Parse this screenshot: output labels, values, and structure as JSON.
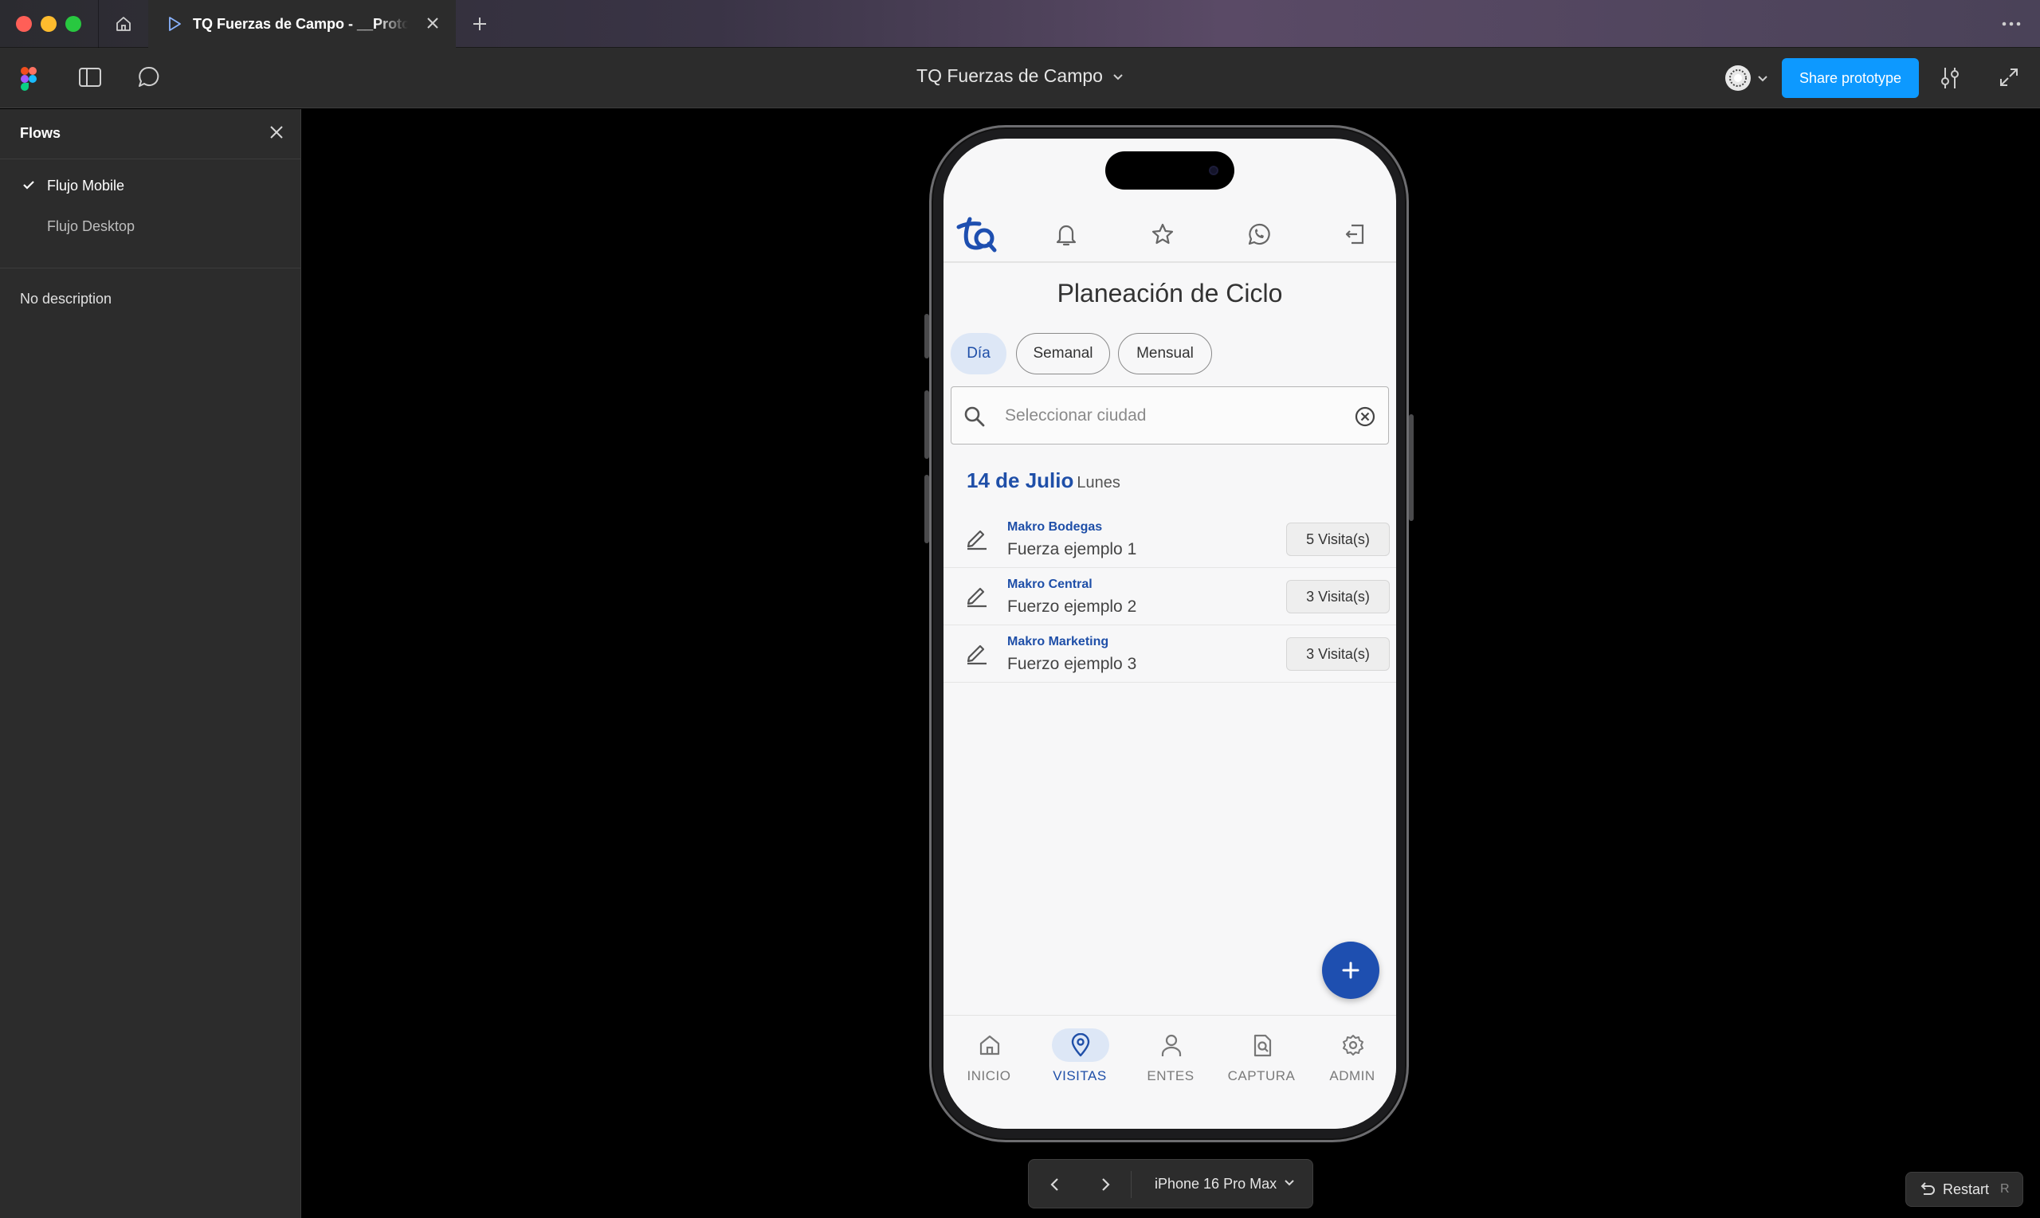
{
  "browser": {
    "tab_title": "TQ Fuerzas de Campo - __Prototipo",
    "new_tab": "+"
  },
  "toolbar": {
    "file_title": "TQ Fuerzas de Campo",
    "share_label": "Share prototype"
  },
  "flows": {
    "title": "Flows",
    "items": [
      {
        "label": "Flujo Mobile",
        "selected": true
      },
      {
        "label": "Flujo Desktop",
        "selected": false
      }
    ],
    "description": "No description"
  },
  "app": {
    "page_title": "Planeación de Ciclo",
    "segments": [
      {
        "label": "Día",
        "active": true
      },
      {
        "label": "Semanal",
        "active": false
      },
      {
        "label": "Mensual",
        "active": false
      }
    ],
    "search": {
      "placeholder": "Seleccionar ciudad"
    },
    "date": {
      "main": "14 de Julio",
      "day": "Lunes"
    },
    "visits": [
      {
        "client": "Makro Bodegas",
        "force": "Fuerza ejemplo 1",
        "badge": "5 Visita(s)"
      },
      {
        "client": "Makro Central",
        "force": "Fuerzo ejemplo 2",
        "badge": "3 Visita(s)"
      },
      {
        "client": "Makro Marketing",
        "force": "Fuerzo ejemplo 3",
        "badge": "3 Visita(s)"
      }
    ],
    "fab_label": "+",
    "nav": [
      {
        "label": "INICIO",
        "icon": "home-icon",
        "active": false
      },
      {
        "label": "VISITAS",
        "icon": "location-pin-icon",
        "active": true
      },
      {
        "label": "ENTES",
        "icon": "person-icon",
        "active": false
      },
      {
        "label": "CAPTURA",
        "icon": "document-search-icon",
        "active": false
      },
      {
        "label": "ADMIN",
        "icon": "gear-icon",
        "active": false
      }
    ]
  },
  "device_bar": {
    "device_name": "iPhone 16 Pro Max"
  },
  "restart": {
    "label": "Restart",
    "shortcut": "R"
  },
  "colors": {
    "brand_blue": "#1f4fa8",
    "figma_share_blue": "#0d99ff",
    "active_pill": "#dde7f6"
  }
}
